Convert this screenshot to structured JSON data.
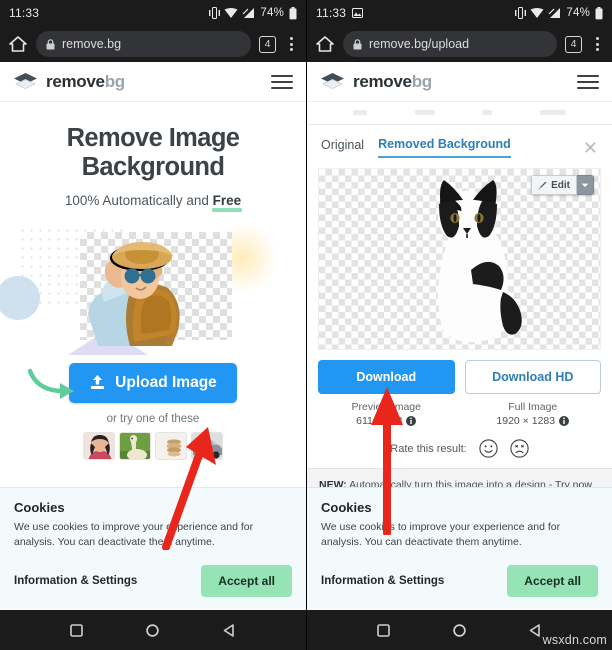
{
  "left": {
    "status": {
      "time": "11:33",
      "battery": "74%"
    },
    "browser": {
      "url": "remove.bg",
      "tab_count": "4"
    },
    "header": {
      "logo_main": "remove",
      "logo_accent": "bg"
    },
    "hero": {
      "title_line1": "Remove Image",
      "title_line2": "Background",
      "subtitle_prefix": "100% Automatically and ",
      "subtitle_highlight": "Free"
    },
    "upload": {
      "button_label": "Upload Image",
      "try_text": "or try one of these",
      "samples": [
        "woman-thumbnail",
        "llama-thumbnail",
        "product-thumbnail",
        "car-thumbnail"
      ]
    },
    "cookies": {
      "title": "Cookies",
      "body": "We use cookies to improve your experience and for analysis. You can deactivate them anytime.",
      "info_label": "Information & Settings",
      "accept_label": "Accept all"
    }
  },
  "right": {
    "status": {
      "time": "11:33",
      "battery": "74%"
    },
    "browser": {
      "url": "remove.bg/upload",
      "tab_count": "4"
    },
    "header": {
      "logo_main": "remove",
      "logo_accent": "bg"
    },
    "tabs": [
      {
        "label": "Original",
        "active": false
      },
      {
        "label": "Removed Background",
        "active": true
      }
    ],
    "preview": {
      "edit_label": "Edit"
    },
    "downloads": [
      {
        "button": "Download",
        "caption": "Preview Image",
        "dims": "611 × 408"
      },
      {
        "button": "Download HD",
        "caption": "Full Image",
        "dims": "1920 × 1283"
      }
    ],
    "rate": {
      "label": "Rate this result:"
    },
    "promo": {
      "badge": "NEW:",
      "text": " Automatically turn this image into a design - ",
      "link": "Try now"
    },
    "cookies": {
      "title": "Cookies",
      "body": "We use cookies to improve your experience and for analysis. You can deactivate them anytime.",
      "info_label": "Information & Settings",
      "accept_label": "Accept all"
    }
  },
  "watermark": "wsxdn.com",
  "colors": {
    "accent_blue": "#2196f3",
    "tab_blue": "#2c7fb8",
    "accent_green": "#96e3b6",
    "annotation_red": "#e8261c",
    "annotation_green": "#5fcc9a",
    "status_bg": "#1b1b1b"
  }
}
